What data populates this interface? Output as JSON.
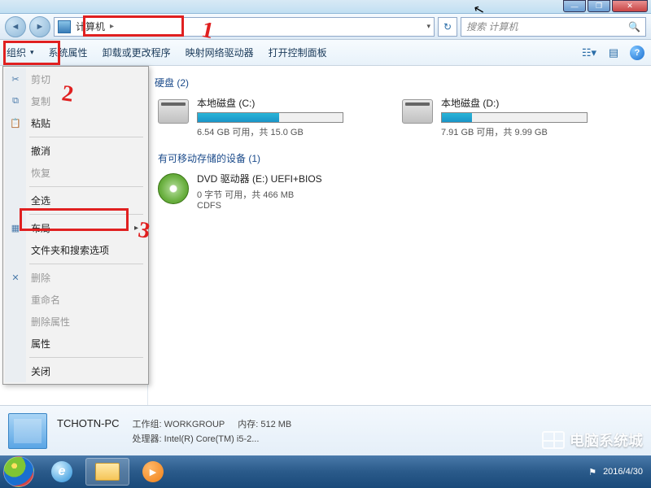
{
  "titlebar": {
    "min": "—",
    "max": "❐",
    "close": "✕"
  },
  "nav": {
    "back": "◄",
    "fwd": "►",
    "address": "计算机",
    "arrow": "▸",
    "refresh": "↻",
    "search_placeholder": "搜索 计算机",
    "mag": "🔍"
  },
  "toolbar": {
    "organize": "组织",
    "sysprops": "系统属性",
    "uninstall": "卸载或更改程序",
    "mapdrive": "映射网络驱动器",
    "controlpanel": "打开控制面板"
  },
  "menu": {
    "cut": "剪切",
    "copy": "复制",
    "paste": "粘贴",
    "undo": "撤消",
    "redo": "恢复",
    "selectall": "全选",
    "layout": "布局",
    "folderopts": "文件夹和搜索选项",
    "delete": "删除",
    "rename": "重命名",
    "removeprops": "删除属性",
    "properties": "属性",
    "close": "关闭"
  },
  "content": {
    "hdd_section": "硬盘 (2)",
    "removable_section": "有可移动存储的设备 (1)",
    "drives": [
      {
        "title": "本地磁盘 (C:)",
        "free_text": "6.54 GB 可用，共 15.0 GB",
        "fill_pct": 56
      },
      {
        "title": "本地磁盘 (D:)",
        "free_text": "7.91 GB 可用，共 9.99 GB",
        "fill_pct": 21
      }
    ],
    "dvd": {
      "title": "DVD 驱动器 (E:) UEFI+BIOS",
      "line2": "0 字节 可用，共 466 MB",
      "line3": "CDFS"
    }
  },
  "details": {
    "name": "TCHOTN-PC",
    "workgroup_label": "工作组:",
    "workgroup": "WORKGROUP",
    "mem_label": "内存:",
    "mem": "512 MB",
    "cpu_label": "处理器:",
    "cpu": "Intel(R) Core(TM) i5-2..."
  },
  "tray": {
    "time": "2016/4/30"
  },
  "watermark": "电脑系统城",
  "annotations": {
    "mark1": "1",
    "mark2": "2",
    "mark3": "3"
  }
}
